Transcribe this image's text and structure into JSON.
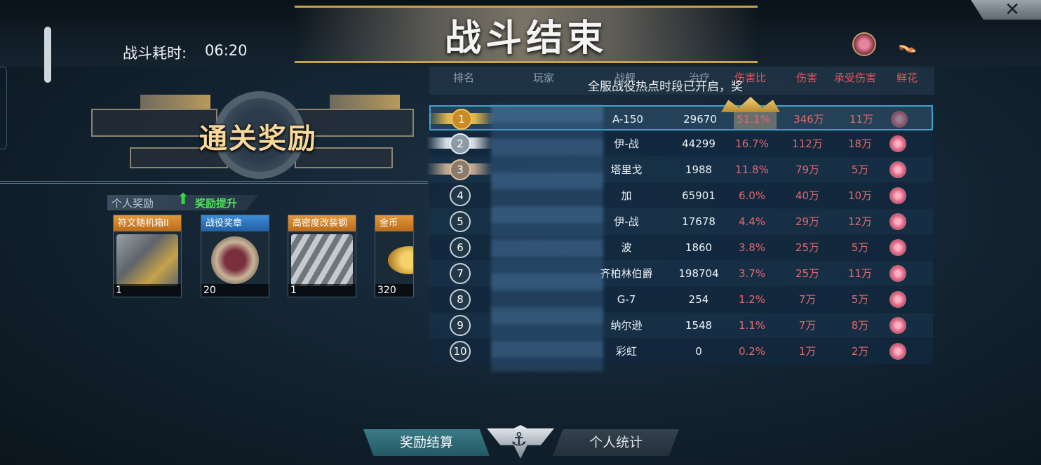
{
  "header": {
    "title": "战斗结束",
    "duration_label": "战斗耗时:",
    "duration_value": "06:20",
    "close_label": "✕"
  },
  "rewards": {
    "emblem_title": "通关奖励",
    "personal_label": "个人奖励",
    "boost_label": "奖励提升",
    "items": [
      {
        "name": "符文随机箱II",
        "count": "1",
        "color": "#e2983a",
        "icon": "rune-chest-icon"
      },
      {
        "name": "战役奖章",
        "count": "20",
        "color": "#3b8dd8",
        "icon": "campaign-medal-icon"
      },
      {
        "name": "高密度改装钢",
        "count": "1",
        "color": "#e2983a",
        "icon": "steel-beam-icon"
      },
      {
        "name": "金币",
        "count": "320",
        "color": "#e2983a",
        "icon": "gold-coin-icon"
      }
    ]
  },
  "table": {
    "headers": [
      "排名",
      "玩家",
      "战舰",
      "治疗",
      "伤害比",
      "伤害",
      "承受伤害",
      "鲜花"
    ],
    "notice": "全服战役热点时段已开启，奖",
    "rows": [
      {
        "rank": "1",
        "ship": "A-150",
        "heal": "29670",
        "ratio": "51.1%",
        "damage": "346万",
        "taken": "11万"
      },
      {
        "rank": "2",
        "ship": "伊-战",
        "heal": "44299",
        "ratio": "16.7%",
        "damage": "112万",
        "taken": "18万"
      },
      {
        "rank": "3",
        "ship": "塔里戈",
        "heal": "1988",
        "ratio": "11.8%",
        "damage": "79万",
        "taken": "5万"
      },
      {
        "rank": "4",
        "ship": "加",
        "heal": "65901",
        "ratio": "6.0%",
        "damage": "40万",
        "taken": "10万"
      },
      {
        "rank": "5",
        "ship": "伊-战",
        "heal": "17678",
        "ratio": "4.4%",
        "damage": "29万",
        "taken": "12万"
      },
      {
        "rank": "6",
        "ship": "波",
        "heal": "1860",
        "ratio": "3.8%",
        "damage": "25万",
        "taken": "5万"
      },
      {
        "rank": "7",
        "ship": "齐柏林伯爵",
        "heal": "198704",
        "ratio": "3.7%",
        "damage": "25万",
        "taken": "11万"
      },
      {
        "rank": "8",
        "ship": "G-7",
        "heal": "254",
        "ratio": "1.2%",
        "damage": "7万",
        "taken": "5万"
      },
      {
        "rank": "9",
        "ship": "纳尔逊",
        "heal": "1548",
        "ratio": "1.1%",
        "damage": "7万",
        "taken": "8万"
      },
      {
        "rank": "10",
        "ship": "彩虹",
        "heal": "0",
        "ratio": "0.2%",
        "damage": "1万",
        "taken": "2万"
      }
    ]
  },
  "nav": {
    "reward_button": "奖励结算",
    "personal_button": "个人统计"
  }
}
